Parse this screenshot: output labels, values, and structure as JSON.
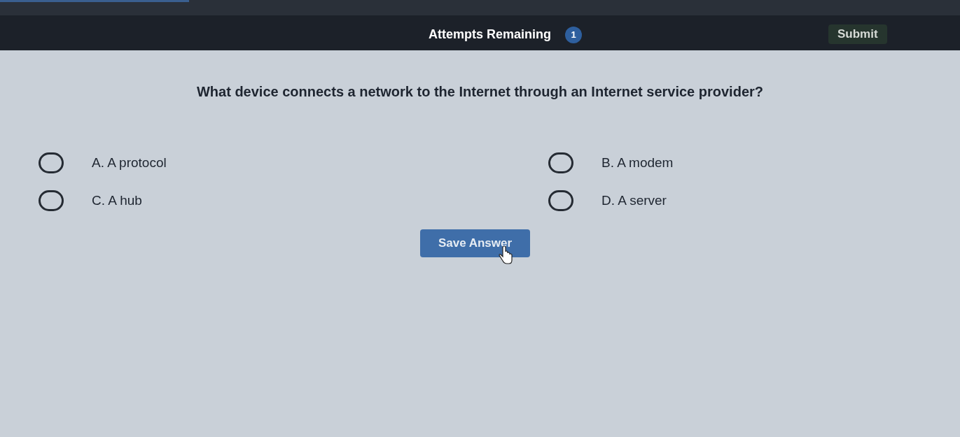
{
  "header": {
    "attempts_label": "Attempts Remaining",
    "attempts_count": "1",
    "submit": "Submit"
  },
  "question": "What device connects a network to the Internet through an Internet service provider?",
  "options": [
    {
      "label": "A. A protocol",
      "selected": false
    },
    {
      "label": "B. A modem",
      "selected": false
    },
    {
      "label": "C. A hub",
      "selected": false
    },
    {
      "label": "D. A server",
      "selected": false
    }
  ],
  "save_button": "Save Answer"
}
